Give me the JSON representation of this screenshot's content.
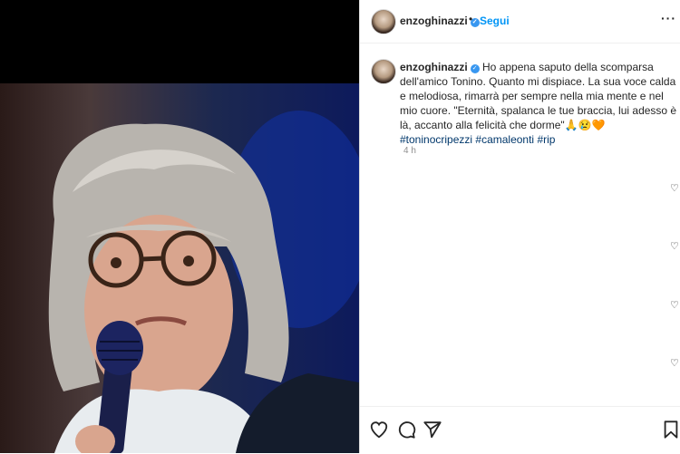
{
  "post": {
    "username": "enzoghinazzi",
    "verified": true,
    "separator": "•",
    "follow_label": "Segui",
    "more_label": "···"
  },
  "caption": {
    "username": "enzoghinazzi",
    "text": "Ho appena saputo della scomparsa dell'amico Tonino. Quanto mi dispiace. La sua voce calda e melodiosa, rimarrà per sempre nella mia mente e nel mio cuore. \"Eternità, spalanca le tue braccia, lui adesso è là, accanto alla felicità che dorme\"",
    "emojis": "🙏😢🧡",
    "hashtags": [
      "#toninocripezzi",
      "#camaleonti",
      "#rip"
    ],
    "timestamp": "4 h"
  },
  "icons": {
    "like": "heart-icon",
    "comment": "comment-icon",
    "share": "paper-plane-icon",
    "save": "bookmark-icon",
    "comment_like": "heart-icon"
  },
  "colors": {
    "link": "#0095f6",
    "hashtag": "#00376b",
    "verified": "#3897f0",
    "muted": "#8e8e8e"
  }
}
